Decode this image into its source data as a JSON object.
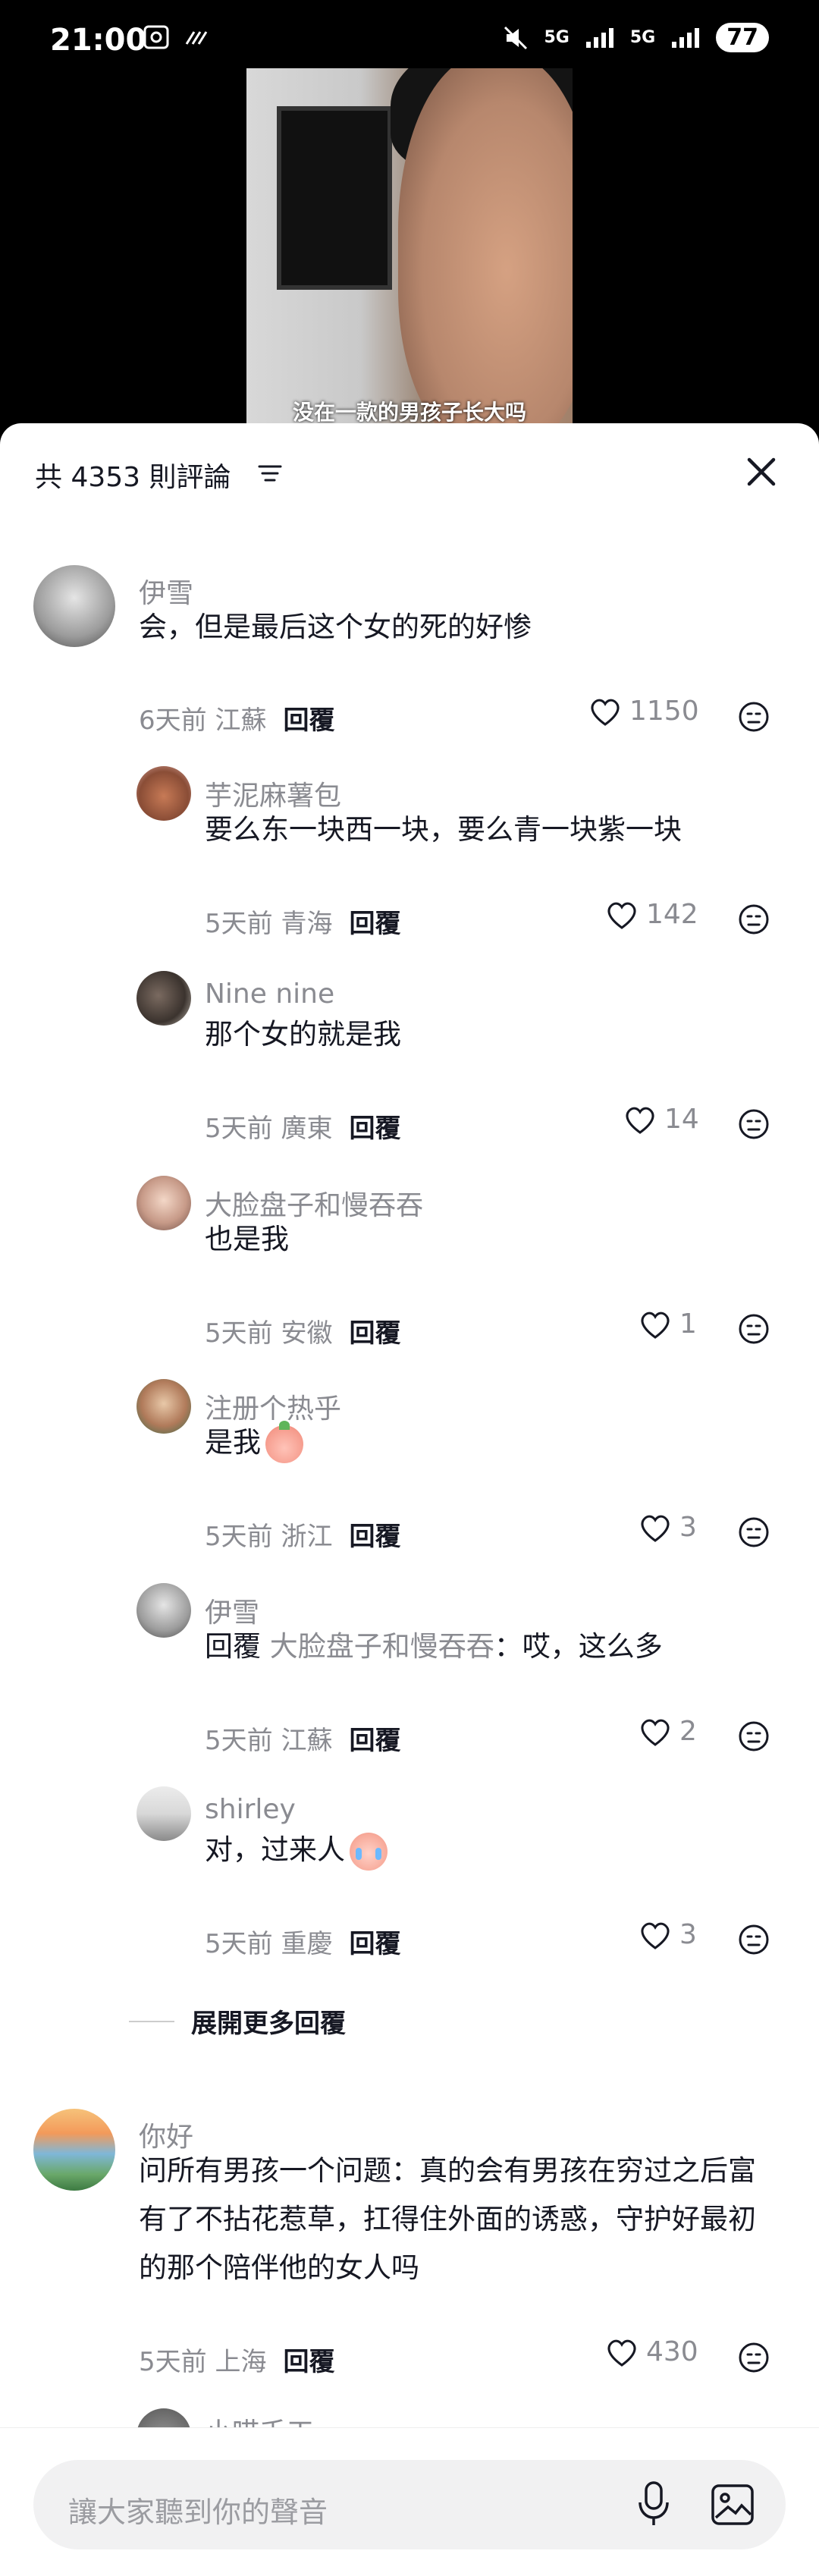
{
  "status_bar": {
    "time": "21:00",
    "battery": "77",
    "net1": "5G",
    "net2": "5G"
  },
  "video": {
    "caption": "没在一款的男孩子长大吗"
  },
  "header": {
    "comment_count": "共 4353 則評論"
  },
  "comments": [
    {
      "name": "伊雪",
      "text": "会，但是最后这个女的死的好惨",
      "time": "6天前",
      "location": "江蘇",
      "reply": "回覆",
      "likes": "1150"
    },
    {
      "name": "芋泥麻薯包",
      "text": "要么东一块西一块，要么青一块紫一块",
      "time": "5天前",
      "location": "青海",
      "reply": "回覆",
      "likes": "142"
    },
    {
      "name": "Nine nine",
      "text": "那个女的就是我",
      "time": "5天前",
      "location": "廣東",
      "reply": "回覆",
      "likes": "14"
    },
    {
      "name": "大脸盘子和慢吞吞",
      "text": "也是我",
      "time": "5天前",
      "location": "安徽",
      "reply": "回覆",
      "likes": "1"
    },
    {
      "name": "注册个热乎",
      "text": "是我",
      "time": "5天前",
      "location": "浙江",
      "reply": "回覆",
      "likes": "3"
    },
    {
      "name": "伊雪",
      "reply_label": "回覆",
      "reply_to": "大脸盘子和慢吞吞",
      "text": "：哎，这么多",
      "time": "5天前",
      "location": "江蘇",
      "reply": "回覆",
      "likes": "2"
    },
    {
      "name": "shirley",
      "text": "对，过来人",
      "time": "5天前",
      "location": "重慶",
      "reply": "回覆",
      "likes": "3"
    },
    {
      "name": "你好",
      "text": "问所有男孩一个问题：真的会有男孩在穷过之后富有了不拈花惹草，扛得住外面的诱惑，守护好最初的那个陪伴他的女人吗",
      "time": "5天前",
      "location": "上海",
      "reply": "回覆",
      "likes": "430"
    }
  ],
  "expand_label": "展開更多回覆",
  "truncated_name": "小喵壬工",
  "input": {
    "placeholder": "讓大家聽到你的聲音"
  },
  "icons": [
    "sort-icon",
    "close-icon",
    "heart-icon",
    "dislike-icon",
    "mic-icon",
    "image-icon"
  ]
}
